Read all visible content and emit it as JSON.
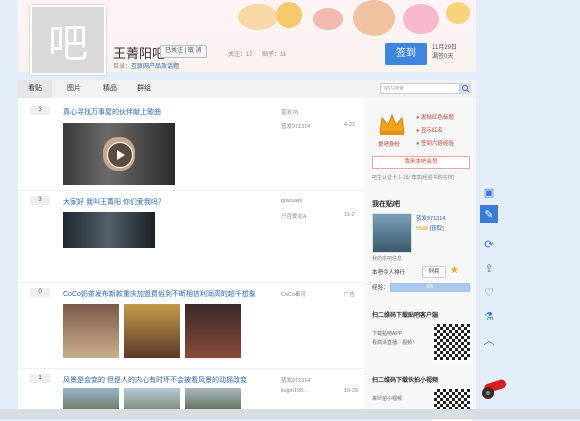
{
  "header": {
    "forum_name": "王菁阳吧",
    "follow_label": "已关注 | 取 消",
    "followers_label": "关注：",
    "followers": "17",
    "posts_label": "贴子：",
    "posts": "11",
    "dir_label": "目录：",
    "dir_link": "互联网产品及话题",
    "avatar_char": "吧",
    "checkin_label": "签到",
    "date": "11月29日",
    "missed": "漏签0天"
  },
  "tabs": [
    "看贴",
    "图片",
    "精品",
    "群组"
  ],
  "search": {
    "placeholder": "吧内搜索"
  },
  "posts": [
    {
      "replies": "3",
      "title": "真心寻找万事屋的伙伴献上歌曲",
      "author": "蓝发78",
      "last": "蓝发971314",
      "time": "4-22"
    },
    {
      "replies": "3",
      "title": "大家好 我叫王菁阳 你们爱我吗？",
      "author": "ppwsaini",
      "last": "只否爱北4",
      "time": "11-2"
    },
    {
      "replies": "0",
      "title": "CoCo奶茶发布新款重庆加盟费俗到不断相信利润高的超千想象",
      "author": "CoCo都可",
      "last": "",
      "time": "广告"
    },
    {
      "replies": "1",
      "title": "风景是会变的 但是人的内心有时坏不会被看风景的动摇改变",
      "author": "蓝发971314",
      "last": "liugin198...",
      "time": "10-25"
    }
  ],
  "side": {
    "badge_label": "爱吧身份",
    "perks": [
      "发帖红色标题",
      "显示红名",
      "签到六倍经验"
    ],
    "buy_button": "我来本吧会员",
    "rent_text": "吧主认证卡 1-18/ 尊享[经验书购买权]",
    "my_bar": "我在贴吧",
    "username": "蓝发971314",
    "coins": "5588",
    "coin_link": "[获取]",
    "my_info": "我的本吧信息",
    "rank_label": "本吧今人排行",
    "rank_btn": "列兵",
    "exp_label": "经验：",
    "exp_value": "5/5",
    "qr_title": "扫二维码下载贴吧客户端",
    "qr_line1": "下载贴吧APP",
    "qr_line2": "看高清直播、视频！",
    "qr2_title": "扫二维码下载伙拍小视频",
    "qr2_line1": "来伙拍小视频"
  },
  "colors": {
    "accent": "#3e86d9",
    "link": "#2d64b3",
    "bg": "#e4eef8"
  }
}
